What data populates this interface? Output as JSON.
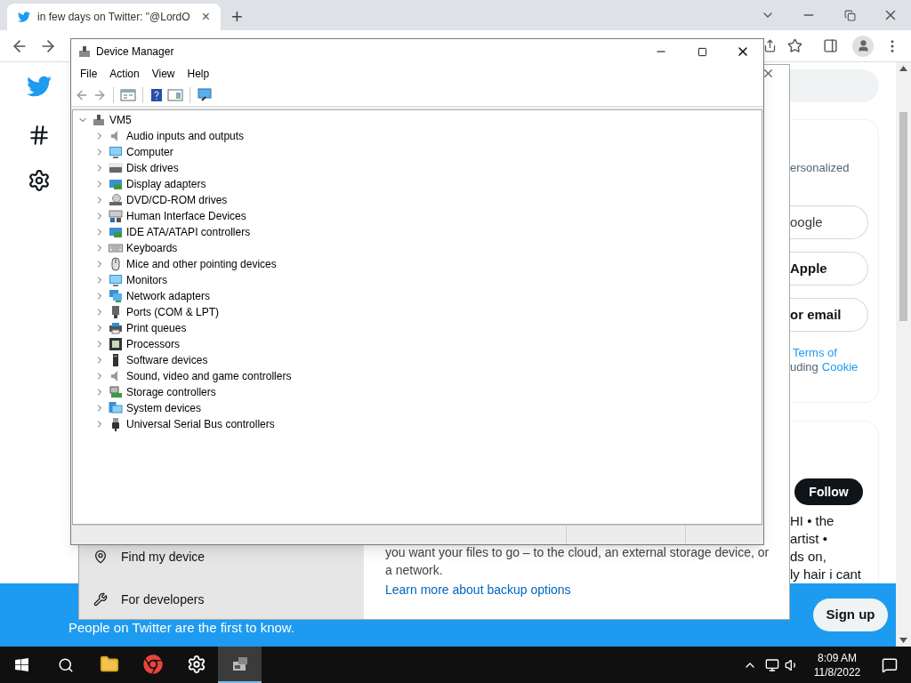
{
  "browser": {
    "tab": {
      "title": "in few days on Twitter: \"@LordO",
      "close": "×",
      "selected": true
    },
    "new_tab": "+"
  },
  "twitter": {
    "card_text": "ersonalized",
    "sign_in_buttons": [
      {
        "label": "oogle",
        "bold": false
      },
      {
        "label": "Apple",
        "bold": true
      },
      {
        "label": "or email",
        "bold": true
      }
    ],
    "terms_lines": [
      [
        {
          "text": "Terms of",
          "link": true
        }
      ],
      [
        {
          "text": "uding",
          "link": false
        },
        {
          "text": "Cookie",
          "link": true
        }
      ]
    ],
    "follow_button": "Follow",
    "bio_lines": [
      "HI • the",
      "artist •",
      "ds on,",
      "ly hair i cant"
    ],
    "banner": {
      "subtitle": "People on Twitter are the first to know.",
      "signup": "Sign up"
    }
  },
  "settings_window": {
    "sidebar_items": [
      {
        "label": "Find my device",
        "kind": "locate"
      },
      {
        "label": "For developers",
        "kind": "tools"
      }
    ],
    "body_lines": [
      "you want your files to go – to the cloud, an external storage device, or",
      "a network."
    ],
    "link": "Learn more about backup options"
  },
  "device_manager": {
    "title": "Device Manager",
    "menu": [
      "File",
      "Action",
      "View",
      "Help"
    ],
    "tree": {
      "label": "VM5",
      "expanded": true,
      "children": [
        {
          "label": "Audio inputs and outputs",
          "kind": "speaker",
          "expanded": false
        },
        {
          "label": "Computer",
          "kind": "monitor",
          "expanded": false
        },
        {
          "label": "Disk drives",
          "kind": "drive",
          "expanded": false
        },
        {
          "label": "Display adapters",
          "kind": "card",
          "expanded": false
        },
        {
          "label": "DVD/CD-ROM drives",
          "kind": "disc",
          "expanded": false
        },
        {
          "label": "Human Interface Devices",
          "kind": "hid",
          "expanded": false
        },
        {
          "label": "IDE ATA/ATAPI controllers",
          "kind": "card",
          "expanded": false
        },
        {
          "label": "Keyboards",
          "kind": "keyboard",
          "expanded": false
        },
        {
          "label": "Mice and other pointing devices",
          "kind": "mouse",
          "expanded": false
        },
        {
          "label": "Monitors",
          "kind": "monitor",
          "expanded": false
        },
        {
          "label": "Network adapters",
          "kind": "network",
          "expanded": false
        },
        {
          "label": "Ports (COM & LPT)",
          "kind": "port",
          "expanded": false
        },
        {
          "label": "Print queues",
          "kind": "printer",
          "expanded": false
        },
        {
          "label": "Processors",
          "kind": "chip",
          "expanded": false
        },
        {
          "label": "Software devices",
          "kind": "tower",
          "expanded": false
        },
        {
          "label": "Sound, video and game controllers",
          "kind": "speaker",
          "expanded": false
        },
        {
          "label": "Storage controllers",
          "kind": "storage",
          "expanded": false
        },
        {
          "label": "System devices",
          "kind": "system",
          "expanded": false
        },
        {
          "label": "Universal Serial Bus controllers",
          "kind": "usb",
          "expanded": false
        }
      ]
    }
  },
  "taskbar": {
    "apps": [
      {
        "kind": "explorer",
        "selected": false
      },
      {
        "kind": "chrome",
        "selected": false
      },
      {
        "kind": "settings",
        "selected": false
      },
      {
        "kind": "devmgr",
        "selected": true
      }
    ],
    "time": "8:09 AM",
    "date": "11/8/2022"
  }
}
